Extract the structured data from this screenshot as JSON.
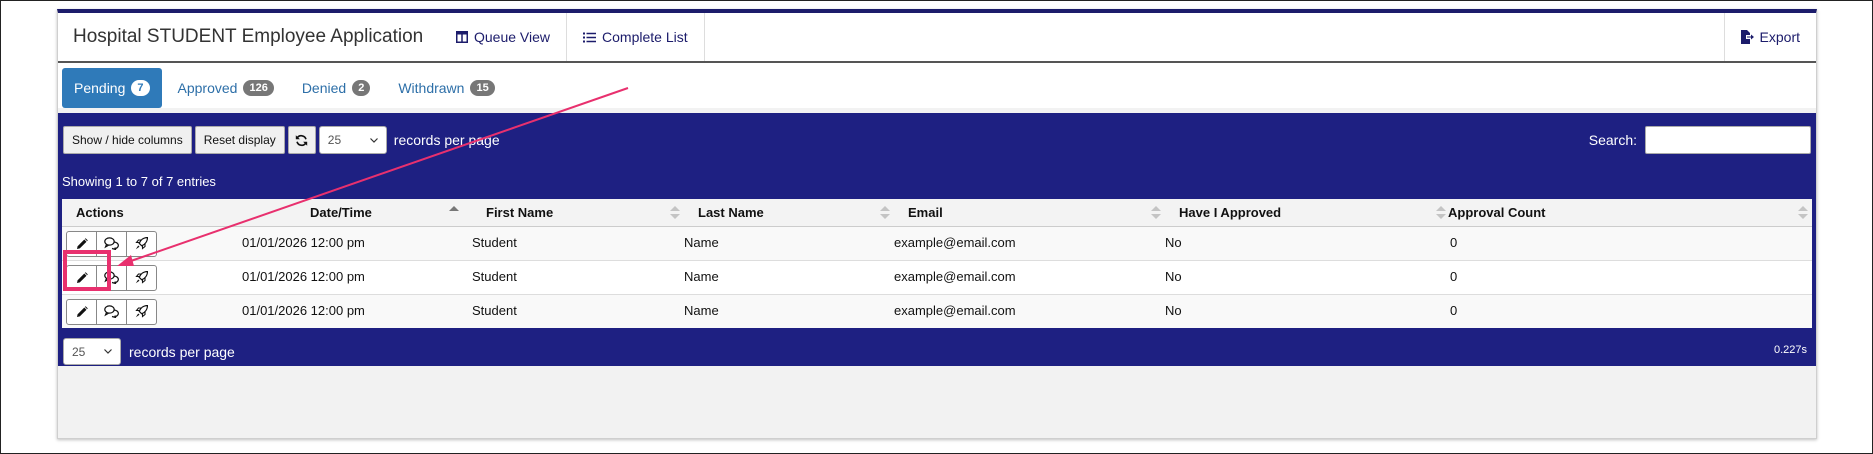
{
  "header": {
    "title": "Hospital STUDENT Employee Application",
    "queue_view": "Queue View",
    "complete_list": "Complete List",
    "export": "Export"
  },
  "tabs": [
    {
      "label": "Pending",
      "count": "7"
    },
    {
      "label": "Approved",
      "count": "126"
    },
    {
      "label": "Denied",
      "count": "2"
    },
    {
      "label": "Withdrawn",
      "count": "15"
    }
  ],
  "toolbar": {
    "show_hide": "Show / hide columns",
    "reset": "Reset display",
    "per_page_value": "25",
    "per_page_label": "records per page",
    "search_label": "Search:",
    "search_value": ""
  },
  "info": "Showing 1 to 7 of 7 entries",
  "table": {
    "headers": [
      "Actions",
      "Date/Time",
      "First Name",
      "Last Name",
      "Email",
      "Have I Approved",
      "Approval Count"
    ],
    "rows": [
      {
        "datetime": "01/01/2026 12:00 pm",
        "first": "Student",
        "last": "Name",
        "email": "example@email.com",
        "approved": "No",
        "count": "0"
      },
      {
        "datetime": "01/01/2026 12:00 pm",
        "first": "Student",
        "last": "Name",
        "email": "example@email.com",
        "approved": "No",
        "count": "0"
      },
      {
        "datetime": "01/01/2026 12:00 pm",
        "first": "Student",
        "last": "Name",
        "email": "example@email.com",
        "approved": "No",
        "count": "0"
      }
    ]
  },
  "footer": {
    "per_page_value": "25",
    "per_page_label": "records per page",
    "timing": "0.227s"
  },
  "icons": {
    "queue_view": "columns-icon",
    "complete_list": "list-icon",
    "export": "file-export-icon",
    "refresh": "refresh-icon",
    "edit": "pencil-icon",
    "comments": "comments-icon",
    "submit": "rocket-icon"
  },
  "colors": {
    "brand": "#1e2082",
    "tab_active": "#2f7ab9",
    "annotation": "#e8306e"
  }
}
